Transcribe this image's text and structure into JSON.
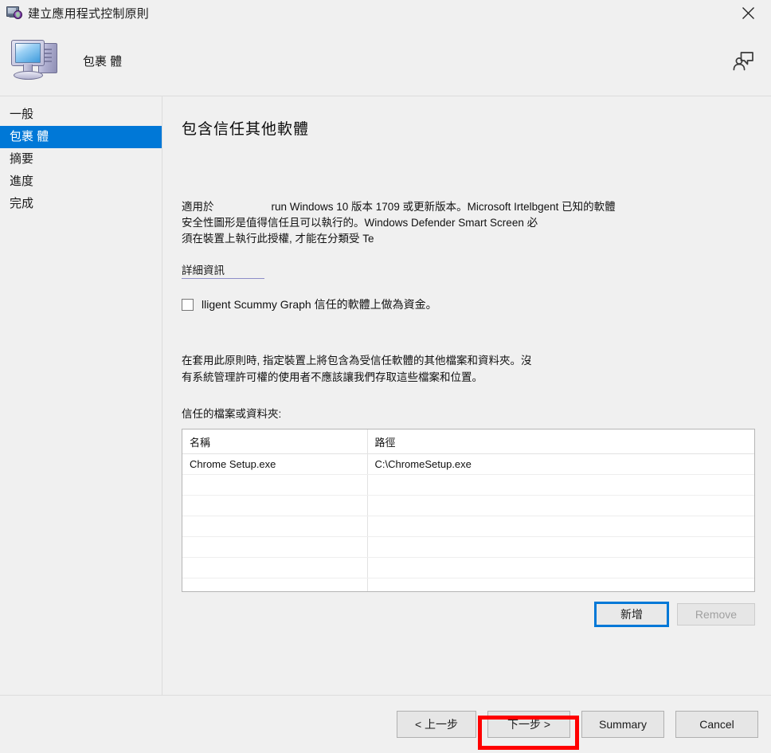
{
  "window": {
    "title": "建立應用程式控制原則",
    "icon": "computer-globe-icon",
    "close_label": "×"
  },
  "banner": {
    "title": "包裹 體",
    "icon": "computer-icon",
    "feedback_icon": "feedback-person-icon"
  },
  "sidebar": {
    "items": [
      {
        "label": "一般",
        "selected": false
      },
      {
        "label": "包裹 體",
        "selected": true
      },
      {
        "label": "摘要",
        "selected": false
      },
      {
        "label": "進度",
        "selected": false
      },
      {
        "label": "完成",
        "selected": false
      }
    ]
  },
  "main": {
    "page_title": "包含信任其他軟體",
    "intro_line1_prefix": "適用於",
    "intro_line1_rest": "run Windows  10 版本 1709 或更新版本。Microsoft  Irtelbgent 已知的軟體",
    "intro_line2": "安全性圖形是值得信任且可以執行的。Windows  Defender  Smart  Screen 必",
    "intro_line3": "須在裝置上執行此授權, 才能在分類受 Te",
    "details_link": "詳細資訊",
    "checkbox_label": "lligent Scummy Graph 信任的軟體上做為資金。",
    "checkbox_checked": false,
    "para2_line1": "在套用此原則時, 指定裝置上將包含為受信任軟體的其他檔案和資料夾。沒",
    "para2_line2": "有系統管理許可權的使用者不應該讓我們存取這些檔案和位置。",
    "list_label": "信任的檔案或資料夾:",
    "table": {
      "columns": [
        "名稱",
        "路徑"
      ],
      "rows": [
        [
          "Chrome Setup.exe",
          "C:\\ChromeSetup.exe"
        ],
        [
          "",
          ""
        ],
        [
          "",
          ""
        ],
        [
          "",
          ""
        ],
        [
          "",
          ""
        ],
        [
          "",
          ""
        ],
        [
          "",
          ""
        ],
        [
          "",
          ""
        ]
      ]
    },
    "add_button": "新增",
    "remove_button": "Remove",
    "remove_disabled": true
  },
  "footer": {
    "back_button": "< 上一步",
    "next_button": "下一步 >",
    "summary_button": "Summary",
    "cancel_button": "Cancel",
    "highlight_color": "#ff0000"
  }
}
